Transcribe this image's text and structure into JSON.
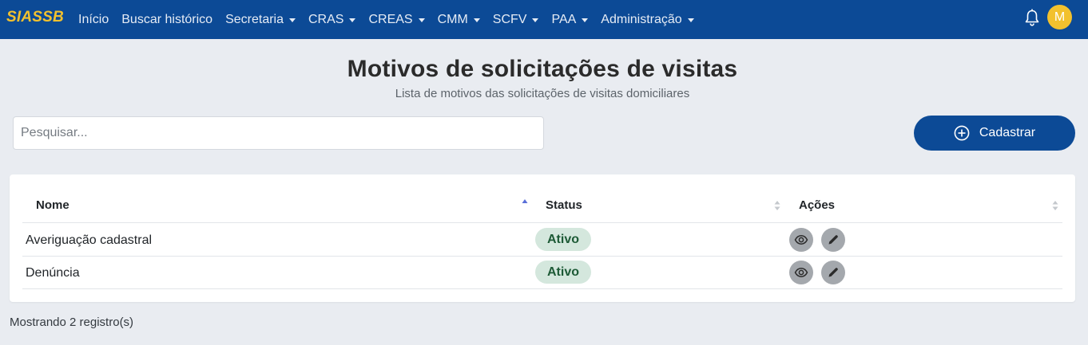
{
  "navbar": {
    "brand": "SIASSB",
    "items": [
      {
        "label": "Início",
        "dropdown": false
      },
      {
        "label": "Buscar histórico",
        "dropdown": false
      },
      {
        "label": "Secretaria",
        "dropdown": true
      },
      {
        "label": "CRAS",
        "dropdown": true
      },
      {
        "label": "CREAS",
        "dropdown": true
      },
      {
        "label": "CMM",
        "dropdown": true
      },
      {
        "label": "SCFV",
        "dropdown": true
      },
      {
        "label": "PAA",
        "dropdown": true
      },
      {
        "label": "Administração",
        "dropdown": true
      }
    ],
    "notification_icon": "bell-icon",
    "avatar_initial": "M"
  },
  "page": {
    "title": "Motivos de solicitações de visitas",
    "subtitle": "Lista de motivos das solicitações de visitas domiciliares"
  },
  "search": {
    "placeholder": "Pesquisar...",
    "value": ""
  },
  "actions": {
    "create_label": "Cadastrar",
    "create_icon": "plus-circle-icon"
  },
  "table": {
    "columns": [
      {
        "label": "Nome",
        "sort": "asc"
      },
      {
        "label": "Status",
        "sort": "none"
      },
      {
        "label": "Ações",
        "sort": "none"
      }
    ],
    "rows": [
      {
        "name": "Averiguação cadastral",
        "status": "Ativo"
      },
      {
        "name": "Denúncia",
        "status": "Ativo"
      }
    ],
    "row_actions": [
      "eye-icon",
      "pencil-icon"
    ]
  },
  "footer": {
    "count_text": "Mostrando 2 registro(s)"
  },
  "colors": {
    "primary": "#0c4a96",
    "brand_yellow": "#f2c12e",
    "badge_bg": "#d4e7dd",
    "badge_text": "#1d5a36",
    "background": "#e9ecf1"
  }
}
